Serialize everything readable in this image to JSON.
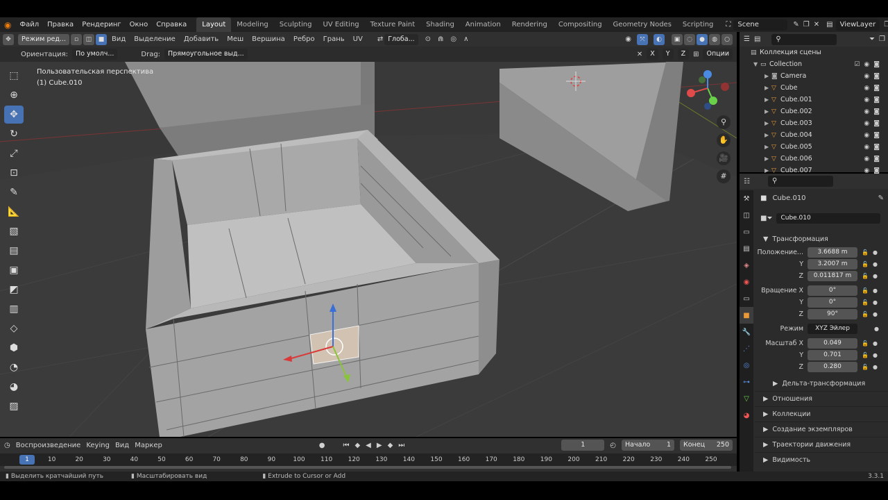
{
  "menu": [
    "Файл",
    "Правка",
    "Рендеринг",
    "Окно",
    "Справка"
  ],
  "workspaces": [
    "Layout",
    "Modeling",
    "Sculpting",
    "UV Editing",
    "Texture Paint",
    "Shading",
    "Animation",
    "Rendering",
    "Compositing",
    "Geometry Nodes",
    "Scripting"
  ],
  "scene": "Scene",
  "view_layer": "ViewLayer",
  "vp_header": {
    "mode": "Режим ред...",
    "items": [
      "Вид",
      "Выделение",
      "Добавить",
      "Меш",
      "Вершина",
      "Ребро",
      "Грань",
      "UV"
    ],
    "transform": "Глоба..."
  },
  "tool_header": {
    "orient_label": "Ориентация:",
    "orient_value": "По умолч...",
    "drag_label": "Drag:",
    "drag_value": "Прямоугольное выд...",
    "axes": [
      "X",
      "Y",
      "Z"
    ],
    "options": "Опции"
  },
  "vp_info": {
    "view": "Пользовательская перспектива",
    "object": "(1) Cube.010"
  },
  "timeline": {
    "playback": "Воспроизведение",
    "keying": "Keying",
    "view": "Вид",
    "marker": "Маркер",
    "current": "1",
    "start_label": "Начало",
    "start": "1",
    "end_label": "Конец",
    "end": "250",
    "ticks": [
      "1",
      "10",
      "20",
      "30",
      "40",
      "50",
      "60",
      "70",
      "80",
      "90",
      "100",
      "110",
      "120",
      "130",
      "140",
      "150",
      "160",
      "170",
      "180",
      "190",
      "200",
      "210",
      "220",
      "230",
      "240",
      "250"
    ]
  },
  "status": [
    "Выделить кратчайший путь",
    "Масштабировать вид",
    "Extrude to Cursor or Add"
  ],
  "version": "3.3.1",
  "outliner": {
    "root": "Коллекция сцены",
    "collection": "Collection",
    "items": [
      "Camera",
      "Cube",
      "Cube.001",
      "Cube.002",
      "Cube.003",
      "Cube.004",
      "Cube.005",
      "Cube.006",
      "Cube.007"
    ]
  },
  "props": {
    "object": "Cube.010",
    "name": "Cube.010",
    "transform": "Трансформация",
    "loc_label": "Положение...",
    "loc": [
      "3.6688 m",
      "3.2007 m",
      "0.011817 m"
    ],
    "rot_label": "Вращение X",
    "rot": [
      "0°",
      "0°",
      "90°"
    ],
    "mode_label": "Режим",
    "mode": "XYZ Эйлер",
    "scale_label": "Масштаб X",
    "scale": [
      "0.049",
      "0.701",
      "0.280"
    ],
    "y": "Y",
    "z": "Z",
    "sections": [
      "Дельта-трансформация",
      "Отношения",
      "Коллекции",
      "Создание экземпляров",
      "Траектории движения",
      "Видимость"
    ]
  },
  "colors": {
    "accent": "#4772b3",
    "object_orange": "#e89a3b"
  }
}
